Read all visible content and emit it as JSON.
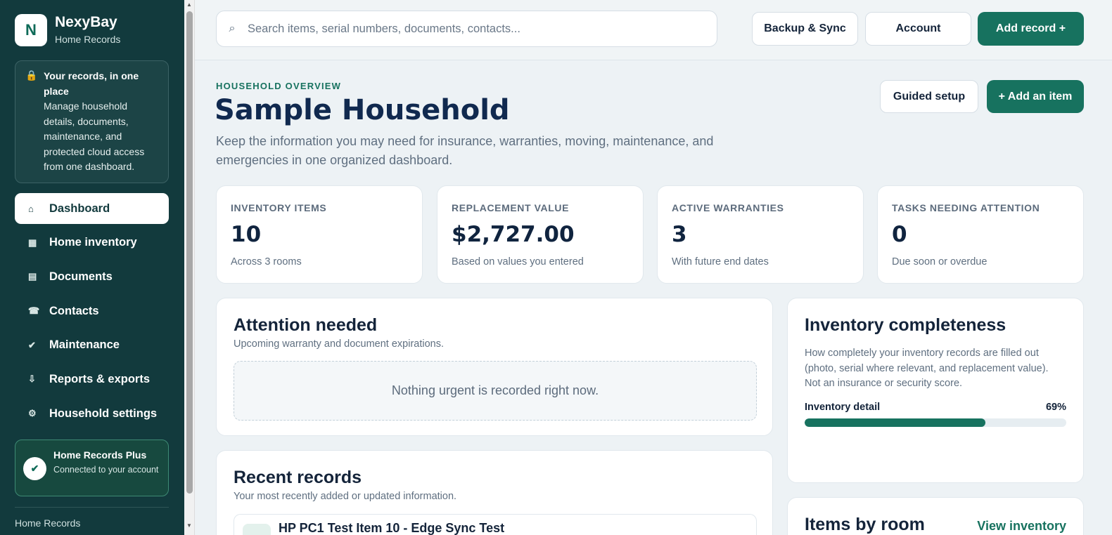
{
  "brand": {
    "logo_letter": "N",
    "name": "NexyBay",
    "subtitle": "Home Records"
  },
  "sidebar": {
    "info": {
      "icon": "lock-icon",
      "title": "Your records, in one place",
      "body": "Manage household details, documents, maintenance, and protected cloud access from one dashboard."
    },
    "items": [
      {
        "label": "Dashboard",
        "icon": "⌂",
        "active": true
      },
      {
        "label": "Home inventory",
        "icon": "▦"
      },
      {
        "label": "Documents",
        "icon": "▤"
      },
      {
        "label": "Contacts",
        "icon": "☎"
      },
      {
        "label": "Maintenance",
        "icon": "✔"
      },
      {
        "label": "Reports & exports",
        "icon": "⇩"
      },
      {
        "label": "Household settings",
        "icon": "⚙"
      }
    ],
    "plan": {
      "title": "Home Records Plus",
      "status": "Connected to your account"
    },
    "footer": "Home Records"
  },
  "topbar": {
    "search_placeholder": "Search items, serial numbers, documents, contacts...",
    "backup_label": "Backup & Sync",
    "account_label": "Account",
    "add_record_label": "Add record  +"
  },
  "overview": {
    "eyebrow": "HOUSEHOLD OVERVIEW",
    "title": "Sample Household",
    "lead": "Keep the information you may need for insurance, warranties, moving, maintenance, and emergencies in one organized dashboard.",
    "guided_label": "Guided setup",
    "add_item_label": "+ Add an item"
  },
  "stats": [
    {
      "label": "INVENTORY ITEMS",
      "value": "10",
      "note": "Across 3 rooms"
    },
    {
      "label": "REPLACEMENT VALUE",
      "value": "$2,727.00",
      "note": "Based on values you entered"
    },
    {
      "label": "ACTIVE WARRANTIES",
      "value": "3",
      "note": "With future end dates"
    },
    {
      "label": "TASKS NEEDING ATTENTION",
      "value": "0",
      "note": "Due soon or overdue"
    }
  ],
  "attention": {
    "title": "Attention needed",
    "subtitle": "Upcoming warranty and document expirations.",
    "empty": "Nothing urgent is recorded right now."
  },
  "completeness": {
    "title": "Inventory completeness",
    "description": "How completely your inventory records are filled out (photo, serial where relevant, and replacement value). Not an insurance or security score.",
    "meter_label": "Inventory detail",
    "meter_value": "69%",
    "meter_fraction": 0.69
  },
  "recent": {
    "title": "Recent records",
    "subtitle": "Your most recently added or updated information.",
    "first_item": "HP PC1 Test Item 10 - Edge Sync Test"
  },
  "rooms": {
    "title": "Items by room",
    "link": "View inventory"
  },
  "colors": {
    "sidebar": "#123a3d",
    "accent": "#17725f",
    "background": "#edf2f5"
  }
}
